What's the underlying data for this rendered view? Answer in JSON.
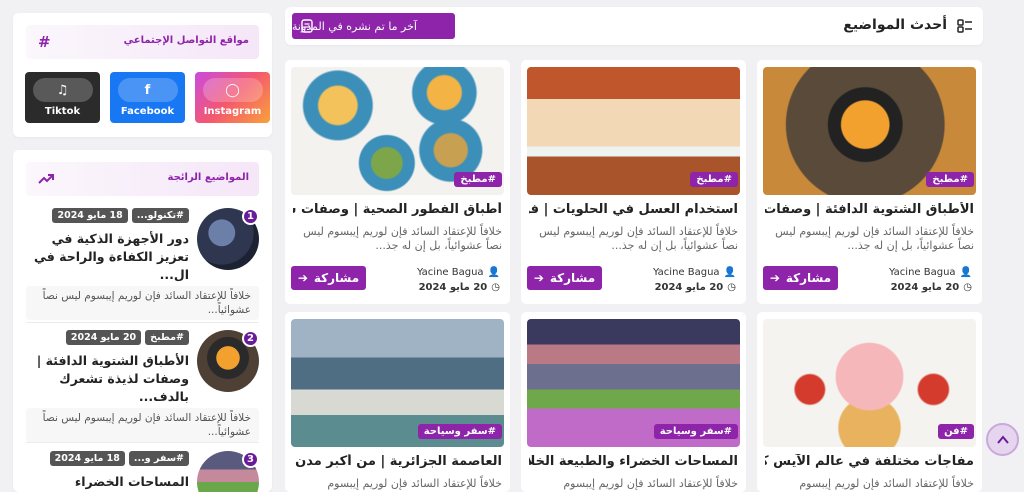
{
  "header": {
    "title": "أحدث المواضيع",
    "latest_button": "آخر ما تم نشره في المدونة"
  },
  "posts": [
    {
      "title": "الأطباق الشتوية الدافئة | وصفات لذي...",
      "tag": "#مطبخ",
      "excerpt": "خلافاً للإعتقاد السائد فإن لوريم إيبسوم ليس نصاً عشوائياً، بل إن له جذ...",
      "author": "Yacine Bagua",
      "date": "20 مايو 2024",
      "share": "مشاركة"
    },
    {
      "title": "استخدام العسل في الحلويات | فوائ...",
      "tag": "#مطبخ",
      "excerpt": "خلافاً للإعتقاد السائد فإن لوريم إيبسوم ليس نصاً عشوائياً، بل إن له جذ...",
      "author": "Yacine Bagua",
      "date": "20 مايو 2024",
      "share": "مشاركة"
    },
    {
      "title": "أطباق الفطور الصحية | وصفات سهل...",
      "tag": "#مطبخ",
      "excerpt": "خلافاً للإعتقاد السائد فإن لوريم إيبسوم ليس نصاً عشوائياً، بل إن له جذ...",
      "author": "Yacine Bagua",
      "date": "20 مايو 2024",
      "share": "مشاركة"
    },
    {
      "title": "مفاجآت مختلفة في عالم الآيس كر...",
      "tag": "#فن",
      "excerpt": "خلافاً للإعتقاد السائد فإن لوريم إيبسوم"
    },
    {
      "title": "المساحات الخضراء والطبيعة الخلابة",
      "tag": "#سفر وسياحة",
      "excerpt": "خلافاً للإعتقاد السائد فإن لوريم إيبسوم"
    },
    {
      "title": "العاصمة الجزائرية | من أكبر مدن الجز...",
      "tag": "#سفر وسياحة",
      "excerpt": "خلافاً للإعتقاد السائد فإن لوريم إيبسوم"
    }
  ],
  "social": {
    "heading": "مواقع التواصل الإجتماعي",
    "buttons": [
      {
        "label": "Instagram",
        "icon": "instagram-icon",
        "color": "#e1306c"
      },
      {
        "label": "Facebook",
        "icon": "facebook-icon",
        "color": "#1877f2"
      },
      {
        "label": "Tiktok",
        "icon": "tiktok-icon",
        "color": "#2b2b2b"
      }
    ]
  },
  "trending": {
    "heading": "المواضيع الرائجة",
    "items": [
      {
        "num": "1",
        "tag": "#تكنولو...",
        "date": "18 مايو 2024",
        "title": "دور الأجهزة الذكية في تعزيز الكفاءة والراحة في ال...",
        "excerpt": "خلافاً للإعتقاد السائد فإن لوريم إيبسوم ليس نصاً عشوائياً..."
      },
      {
        "num": "2",
        "tag": "#مطبخ",
        "date": "20 مايو 2024",
        "title": "الأطباق الشتوية الدافئة | وصفات لذيذة تشعرك بالدف...",
        "excerpt": "خلافاً للإعتقاد السائد فإن لوريم إيبسوم ليس نصاً عشوائياً..."
      },
      {
        "num": "3",
        "tag": "#سفر و...",
        "date": "18 مايو 2024",
        "title": "المساحات الخضراء والطبيعة",
        "excerpt": ""
      }
    ]
  }
}
